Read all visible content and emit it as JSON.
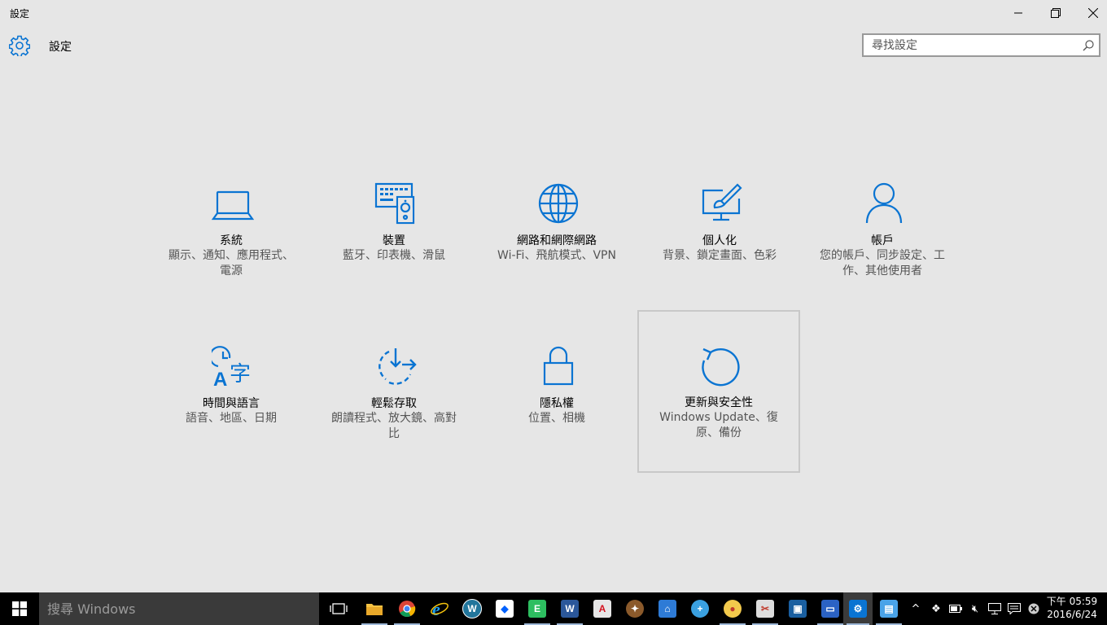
{
  "window": {
    "title": "設定"
  },
  "header": {
    "title": "設定",
    "search_placeholder": "尋找設定"
  },
  "tiles": [
    {
      "name": "系統",
      "desc": "顯示、通知、應用程式、電源",
      "icon": "laptop-icon"
    },
    {
      "name": "裝置",
      "desc": "藍牙、印表機、滑鼠",
      "icon": "devices-icon"
    },
    {
      "name": "網路和網際網路",
      "desc": "Wi-Fi、飛航模式、VPN",
      "icon": "globe-icon"
    },
    {
      "name": "個人化",
      "desc": "背景、鎖定畫面、色彩",
      "icon": "personalization-icon"
    },
    {
      "name": "帳戶",
      "desc": "您的帳戶、同步設定、工作、其他使用者",
      "icon": "person-icon"
    },
    {
      "name": "時間與語言",
      "desc": "語音、地區、日期",
      "icon": "time-language-icon"
    },
    {
      "name": "輕鬆存取",
      "desc": "朗讀程式、放大鏡、高對比",
      "icon": "ease-of-access-icon"
    },
    {
      "name": "隱私權",
      "desc": "位置、相機",
      "icon": "lock-icon"
    },
    {
      "name": "更新與安全性",
      "desc": "Windows Update、復原、備份",
      "icon": "update-icon"
    }
  ],
  "taskbar": {
    "search_placeholder": "搜尋 Windows",
    "apps": [
      "task-view",
      "file-explorer",
      "chrome",
      "internet-explorer",
      "wordpress",
      "dropbox",
      "evernote",
      "word",
      "acrobat",
      "app-bird",
      "network-app",
      "magnifier",
      "paint",
      "tool",
      "virtualbox",
      "remote-desktop",
      "settings",
      "control-panel"
    ],
    "clock_time": "下午 05:59",
    "clock_date": "2016/6/24"
  },
  "colors": {
    "accent": "#0a74d2",
    "background": "#e6e6e6",
    "taskbar": "#000000"
  }
}
